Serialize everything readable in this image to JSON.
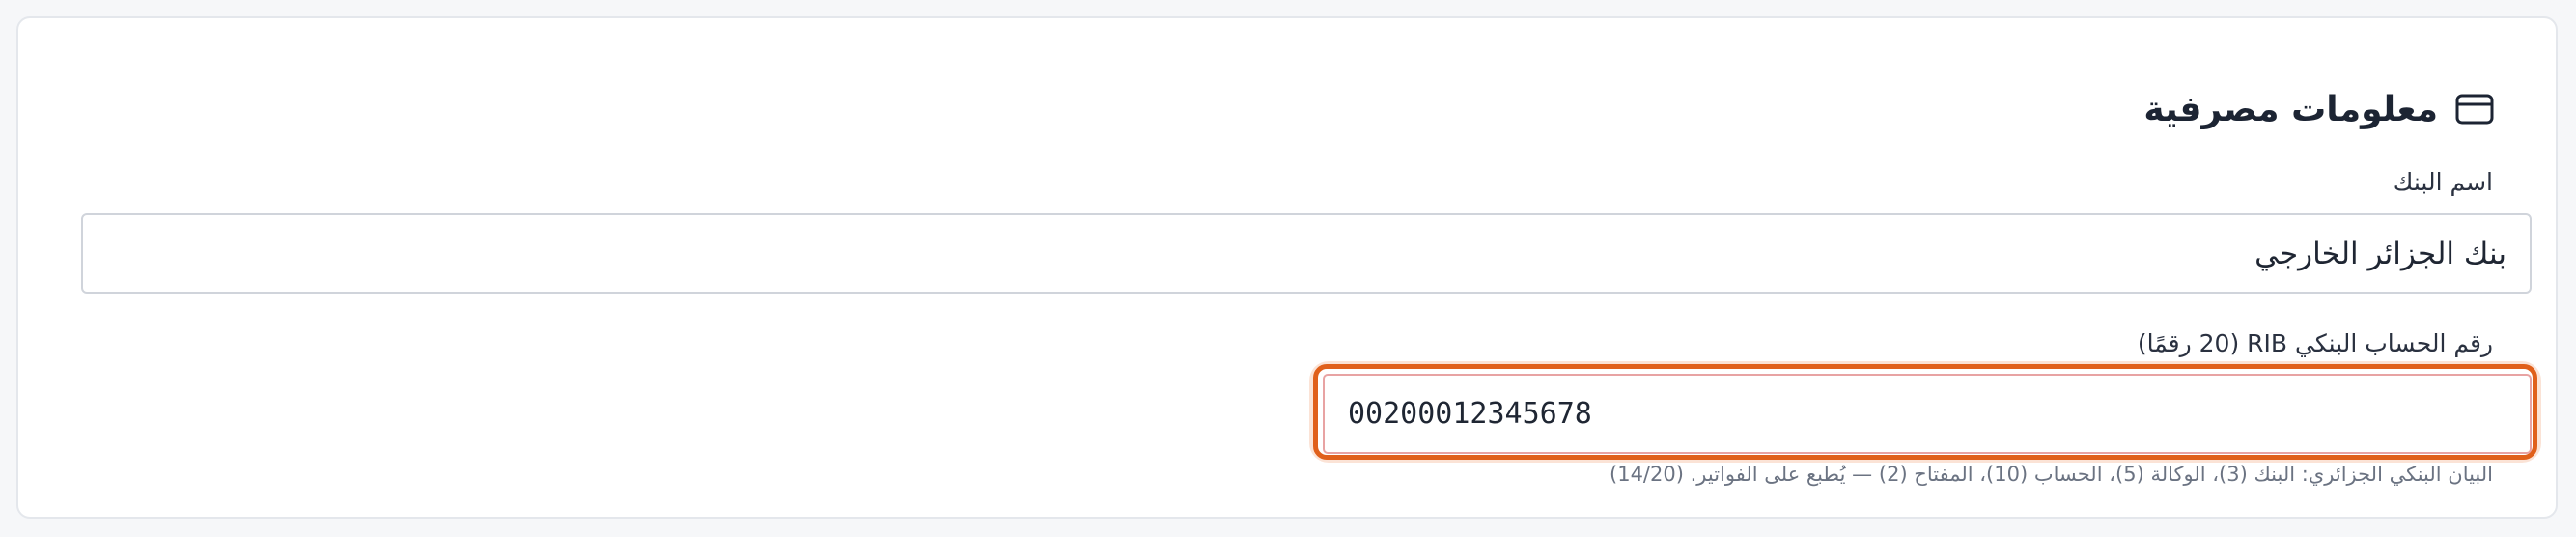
{
  "section": {
    "title": "معلومات مصرفية",
    "icon": "credit-card-icon"
  },
  "bank_name": {
    "label": "اسم البنك",
    "value": "بنك الجزائر الخارجي"
  },
  "rib": {
    "label": "رقم الحساب البنكي RIB (20 رقمًا)",
    "value": "00200012345678",
    "help": "البيان البنكي الجزائري: البنك (3)، الوكالة (5)، الحساب (10)، المفتاح (2) — يُطبع على الفواتير. (14/20)"
  },
  "colors": {
    "focus_accent": "#e0601b",
    "text": "#1f2633"
  }
}
